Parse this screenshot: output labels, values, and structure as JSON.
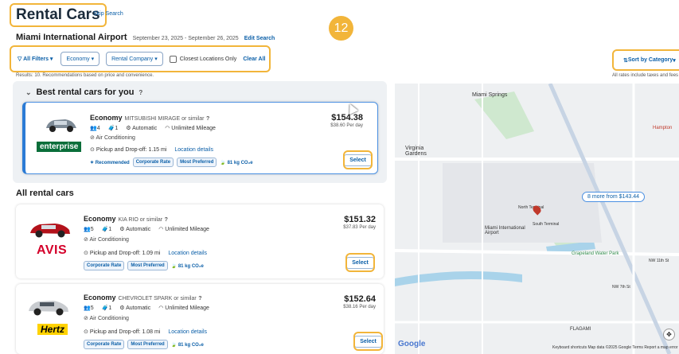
{
  "header": {
    "title": "Rental Cars",
    "skip": "Skip Search",
    "step_badge": "12",
    "location": "Miami International Airport",
    "dates": "September 23, 2025 - September 26, 2025",
    "edit": "Edit Search"
  },
  "filters": {
    "all_filters": "All Filters",
    "economy": "Economy",
    "rental_company": "Rental Company",
    "closest_only": "Closest Locations Only",
    "clear_all": "Clear All"
  },
  "sort": {
    "label": "Sort by Category"
  },
  "results_text": "Results: 10. Recommendations based on price and convenience.",
  "rates_note": "All rates include taxes and fees",
  "best": {
    "heading": "Best rental cars for you"
  },
  "all": {
    "heading": "All rental cars"
  },
  "cars": [
    {
      "class": "Economy",
      "model": "MITSUBISHI MIRAGE or similar",
      "people": "4",
      "bags": "1",
      "transmission": "Automatic",
      "mileage": "Unlimited Mileage",
      "ac": "Air Conditioning",
      "pickup": "Pickup and Drop-off: 1.15 mi",
      "details": "Location details",
      "recommended": "Recommended",
      "corporate": "Corporate Rate",
      "preferred": "Most Preferred",
      "co2": "81 kg CO₂e",
      "price": "$154.38",
      "per_day": "$38.60 Per day",
      "select": "Select",
      "vendor": "enterprise",
      "color": "#7d8a96"
    },
    {
      "class": "Economy",
      "model": "KIA RIO or similar",
      "people": "5",
      "bags": "1",
      "transmission": "Automatic",
      "mileage": "Unlimited Mileage",
      "ac": "Air Conditioning",
      "pickup": "Pickup and Drop-off: 1.09 mi",
      "details": "Location details",
      "corporate": "Corporate Rate",
      "preferred": "Most Preferred",
      "co2": "81 kg CO₂e",
      "price": "$151.32",
      "per_day": "$37.83 Per day",
      "select": "Select",
      "vendor": "AVIS",
      "color": "#b3121b"
    },
    {
      "class": "Economy",
      "model": "CHEVROLET SPARK or similar",
      "people": "5",
      "bags": "1",
      "transmission": "Automatic",
      "mileage": "Unlimited Mileage",
      "ac": "Air Conditioning",
      "pickup": "Pickup and Drop-off: 1.08 mi",
      "details": "Location details",
      "corporate": "Corporate Rate",
      "preferred": "Most Preferred",
      "co2": "81 kg CO₂e",
      "price": "$152.64",
      "per_day": "$38.16 Per day",
      "select": "Select",
      "vendor": "Hertz",
      "color": "#c9ccd0"
    }
  ],
  "map": {
    "labels": {
      "miami_springs": "Miami Springs",
      "virginia_gardens": "Virginia Gardens",
      "north_terminal": "North Terminal",
      "south_terminal": "South Terminal",
      "mia": "Miami International Airport",
      "grapeland": "Grapeland Water Park",
      "flagami": "FLAGAMI",
      "hampton": "Hampton",
      "nw11": "NW 11th St",
      "nw7": "NW 7th St"
    },
    "pill": "8 more from $143.44",
    "brand": "Google",
    "footer": "Keyboard shortcuts   Map data ©2025 Google   Terms   Report a map error"
  }
}
